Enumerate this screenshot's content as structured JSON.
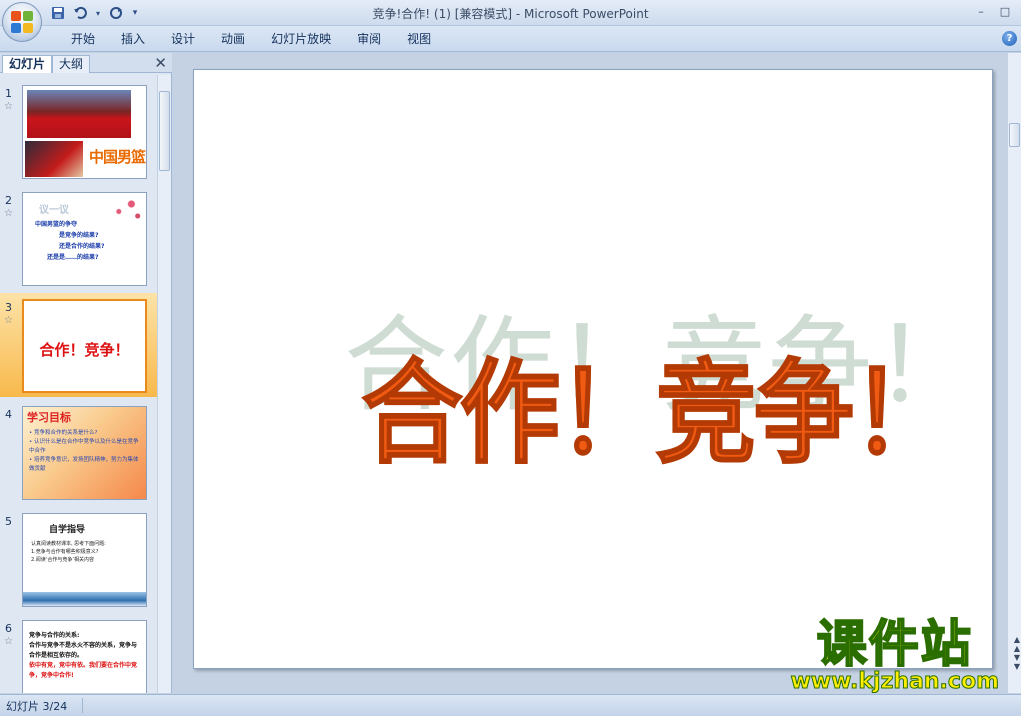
{
  "window": {
    "title": "竞争!合作! (1) [兼容模式] - Microsoft PowerPoint",
    "minimize_glyph": "–",
    "restore_glyph": "□"
  },
  "quick_access": {
    "save_icon": "save-icon",
    "undo_icon": "undo-icon",
    "redo_icon": "redo-icon",
    "customize_icon": "customize-icon"
  },
  "ribbon": {
    "tabs": [
      "开始",
      "插入",
      "设计",
      "动画",
      "幻灯片放映",
      "审阅",
      "视图"
    ],
    "help_label": "?"
  },
  "left_panel": {
    "tabs": {
      "slides": "幻灯片",
      "outline": "大纲"
    },
    "close_glyph": "✕",
    "thumbnails": [
      {
        "number": "1",
        "title": "中国男篮"
      },
      {
        "number": "2",
        "head": "议一议",
        "lines": [
          "中国男篮的争夺",
          "是竞争的结果?",
          "还是合作的结果?",
          "还是是……的结果?"
        ]
      },
      {
        "number": "3",
        "title": "合作！竞争！"
      },
      {
        "number": "4",
        "head": "学习目标",
        "lines": [
          "• 竞争和合作的关系是什么?",
          "• 认识什么是在合作中竞争以及什么是在竞争中合作",
          "• 培养竞争意识，发扬团队精神，努力为集体做贡献"
        ]
      },
      {
        "number": "5",
        "head": "自学指导",
        "lines": [
          "认真阅读教材课本, 思考下面问题:",
          "1.竞争与合作有哪些积极意义?",
          "2.阅读‘合作与竞争’相关内容"
        ]
      },
      {
        "number": "6",
        "lines": [
          "竞争与合作的关系:",
          "合作与竞争不是水火不容的关系，竞争与合作是相互依存的。",
          "依中有竞，竞中有依。我们要在合作中竞争，竞争中合作!"
        ]
      }
    ]
  },
  "slide": {
    "title": "合作！竞争！",
    "shadow_text": "合作！竞争！"
  },
  "watermark": {
    "cn": "课件站",
    "url": "www.kjzhan.com"
  },
  "status": {
    "slide_counter": "幻灯片 3/24"
  }
}
